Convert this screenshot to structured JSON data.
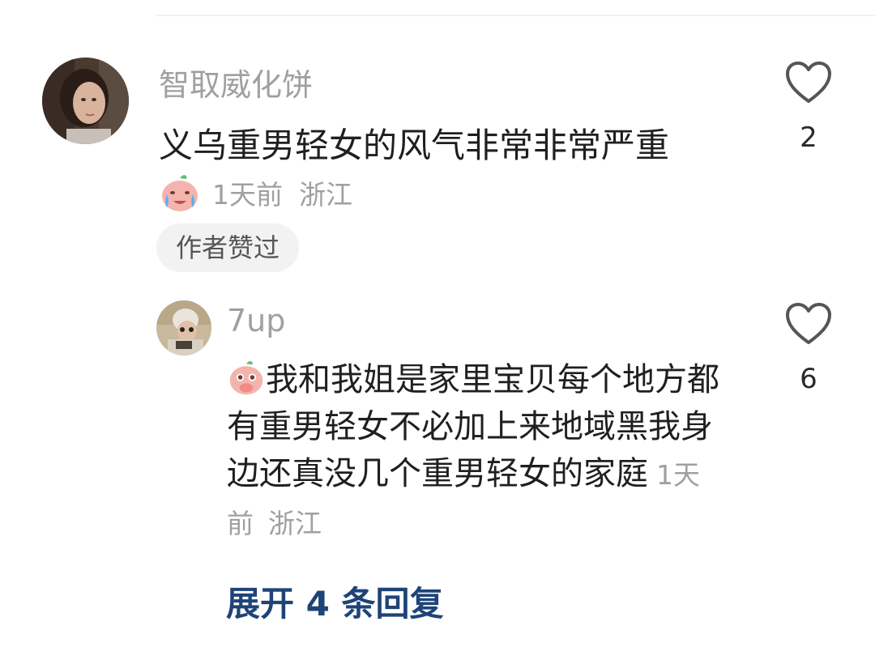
{
  "comment": {
    "username": "智取威化饼",
    "text": "义乌重男轻女的风气非常非常严重",
    "time": "1天前",
    "location": "浙江",
    "like_count": "2",
    "author_liked_label": "作者赞过",
    "avatar_icon": "woman-portrait-avatar",
    "emoji_icon": "crying-peach-emoji-icon"
  },
  "reply": {
    "username": "7up",
    "text": "我和我姐是家里宝贝每个地方都有重男轻女不必加上来地域黑我身边还真没几个重男轻女的家庭",
    "time": "1天前",
    "location": "浙江",
    "like_count": "6",
    "avatar_icon": "person-photo-avatar",
    "emoji_icon": "peach-covering-mouth-emoji-icon"
  },
  "expand_replies_label": "展开 4 条回复",
  "colors": {
    "link": "#1e4477",
    "muted": "#a0a0a0",
    "text": "#1f1f1f"
  }
}
